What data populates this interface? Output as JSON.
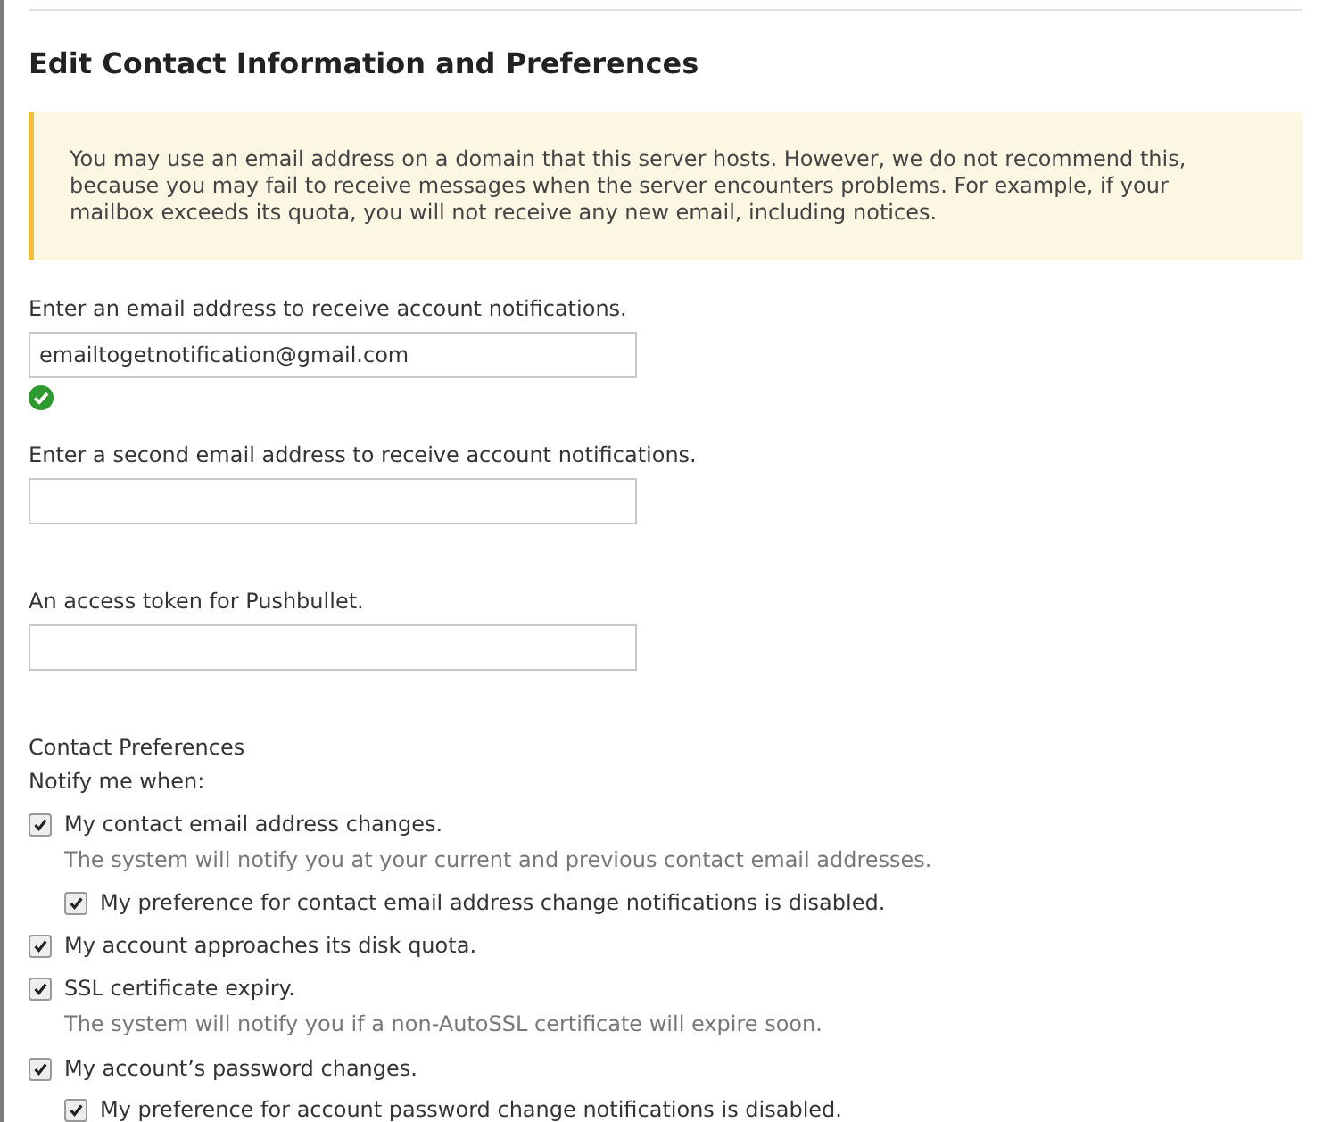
{
  "title": "Edit Contact Information and Preferences",
  "notice": "You may use an email address on a domain that this server hosts. However, we do not recommend this, because you may fail to receive messages when the server encounters problems. For example, if your mailbox exceeds its quota, you will not receive any new email, including notices.",
  "fields": [
    {
      "label": "Enter an email address to receive account notifications.",
      "value": "emailtogetnotification@gmail.com",
      "valid": true
    },
    {
      "label": "Enter a second email address to receive account notifications.",
      "valid": false
    },
    {
      "label": "An access token for Pushbullet.",
      "valid": false
    }
  ],
  "preferences": {
    "heading": "Contact Preferences",
    "subheading": "Notify me when:",
    "options": [
      {
        "label": "My contact email address changes.",
        "checked": true,
        "description": "The system will notify you at your current and previous contact email addresses.",
        "children": [
          {
            "label": "My preference for contact email address change notifications is disabled.",
            "checked": true
          }
        ]
      },
      {
        "label": "My account approaches its disk quota.",
        "checked": true
      },
      {
        "label": "SSL certificate expiry.",
        "checked": true,
        "description": "The system will notify you if a non-AutoSSL certificate will expire soon."
      },
      {
        "label": "My account’s password changes.",
        "checked": true,
        "children": [
          {
            "label": "My preference for account password change notifications is disabled.",
            "checked": true
          }
        ]
      }
    ]
  }
}
